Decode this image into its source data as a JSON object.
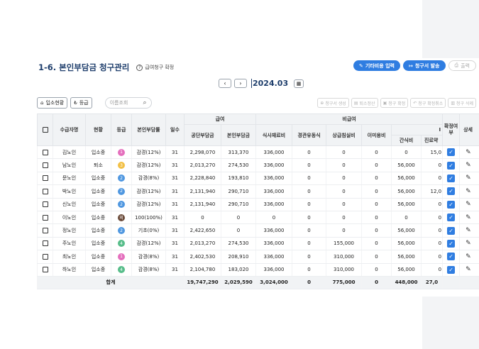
{
  "header": {
    "title": "1-6. 본인부담금 청구관리",
    "help_label": "급여청구 확정",
    "buttons": {
      "other_cost": "기타비용 입력",
      "send_bill": "청구서 발송",
      "print": "출력"
    }
  },
  "period": {
    "month": "2024.03"
  },
  "toolbar": {
    "admission_status": "입소현황",
    "grade": "등급",
    "search_placeholder": "이름조회",
    "create_bill": "청구서 생성",
    "discharge_settle": "퇴소정산",
    "confirm_bill": "청구 확정",
    "cancel_confirm": "청구 확정취소",
    "delete_bill": "청구 삭제"
  },
  "table": {
    "headers": {
      "recipient": "수급자명",
      "status": "현황",
      "grade": "등급",
      "copay_rate": "본인부담률",
      "days": "일수",
      "benefit_group": "급여",
      "public_burden": "공단부담금",
      "self_burden": "본인부담금",
      "nonbenefit_group": "비급여",
      "meal": "식사재료비",
      "extra_long": "경관유동식",
      "room": "상급침실비",
      "beauty": "이미용비",
      "snack": "간식비",
      "medical": "진료약",
      "confirm": "확정여부",
      "detail": "상세"
    },
    "rows": [
      {
        "name": "김노인",
        "status": "입소중",
        "grade": "1",
        "grade_color": "#e46fbd",
        "rate": "감경(12%)",
        "days": "31",
        "public": "2,298,070",
        "self": "313,370",
        "meal": "336,000",
        "extra": "0",
        "room": "0",
        "beauty": "0",
        "snack": "0",
        "medical": "15,0"
      },
      {
        "name": "남노인",
        "status": "퇴소",
        "grade": "3",
        "grade_color": "#f2c046",
        "rate": "감경(12%)",
        "days": "31",
        "public": "2,013,270",
        "self": "274,530",
        "meal": "336,000",
        "extra": "0",
        "room": "0",
        "beauty": "0",
        "snack": "56,000",
        "medical": "0"
      },
      {
        "name": "문노인",
        "status": "입소중",
        "grade": "2",
        "grade_color": "#4f97e0",
        "rate": "감경(8%)",
        "days": "31",
        "public": "2,228,840",
        "self": "193,810",
        "meal": "336,000",
        "extra": "0",
        "room": "0",
        "beauty": "0",
        "snack": "56,000",
        "medical": "0"
      },
      {
        "name": "박노인",
        "status": "입소중",
        "grade": "2",
        "grade_color": "#4f97e0",
        "rate": "감경(12%)",
        "days": "31",
        "public": "2,131,940",
        "self": "290,710",
        "meal": "336,000",
        "extra": "0",
        "room": "0",
        "beauty": "0",
        "snack": "56,000",
        "medical": "12,0"
      },
      {
        "name": "신노인",
        "status": "입소중",
        "grade": "2",
        "grade_color": "#4f97e0",
        "rate": "감경(12%)",
        "days": "31",
        "public": "2,131,940",
        "self": "290,710",
        "meal": "336,000",
        "extra": "0",
        "room": "0",
        "beauty": "0",
        "snack": "56,000",
        "medical": "0"
      },
      {
        "name": "이노인",
        "status": "입소중",
        "grade": "외",
        "grade_color": "#6b4b3a",
        "rate": "100(100%)",
        "days": "31",
        "public": "0",
        "self": "0",
        "meal": "0",
        "extra": "0",
        "room": "0",
        "beauty": "0",
        "snack": "0",
        "medical": "0"
      },
      {
        "name": "정노인",
        "status": "입소중",
        "grade": "2",
        "grade_color": "#4f97e0",
        "rate": "기초(0%)",
        "days": "31",
        "public": "2,422,650",
        "self": "0",
        "meal": "336,000",
        "extra": "0",
        "room": "0",
        "beauty": "0",
        "snack": "56,000",
        "medical": "0"
      },
      {
        "name": "주노인",
        "status": "입소중",
        "grade": "4",
        "grade_color": "#57bd8a",
        "rate": "감경(12%)",
        "days": "31",
        "public": "2,013,270",
        "self": "274,530",
        "meal": "336,000",
        "extra": "0",
        "room": "155,000",
        "beauty": "0",
        "snack": "56,000",
        "medical": "0"
      },
      {
        "name": "최노인",
        "status": "입소중",
        "grade": "1",
        "grade_color": "#e46fbd",
        "rate": "감경(8%)",
        "days": "31",
        "public": "2,402,530",
        "self": "208,910",
        "meal": "336,000",
        "extra": "0",
        "room": "310,000",
        "beauty": "0",
        "snack": "56,000",
        "medical": "0"
      },
      {
        "name": "하노인",
        "status": "입소중",
        "grade": "4",
        "grade_color": "#57bd8a",
        "rate": "감경(8%)",
        "days": "31",
        "public": "2,104,780",
        "self": "183,020",
        "meal": "336,000",
        "extra": "0",
        "room": "310,000",
        "beauty": "0",
        "snack": "56,000",
        "medical": "0"
      }
    ],
    "total": {
      "label": "합계",
      "public": "19,747,290",
      "self": "2,029,590",
      "meal": "3,024,000",
      "extra": "0",
      "room": "775,000",
      "beauty": "0",
      "snack": "448,000",
      "medical": "27,0"
    }
  },
  "colors": {
    "accent": "#2f7de1",
    "title": "#1d3d6b"
  }
}
